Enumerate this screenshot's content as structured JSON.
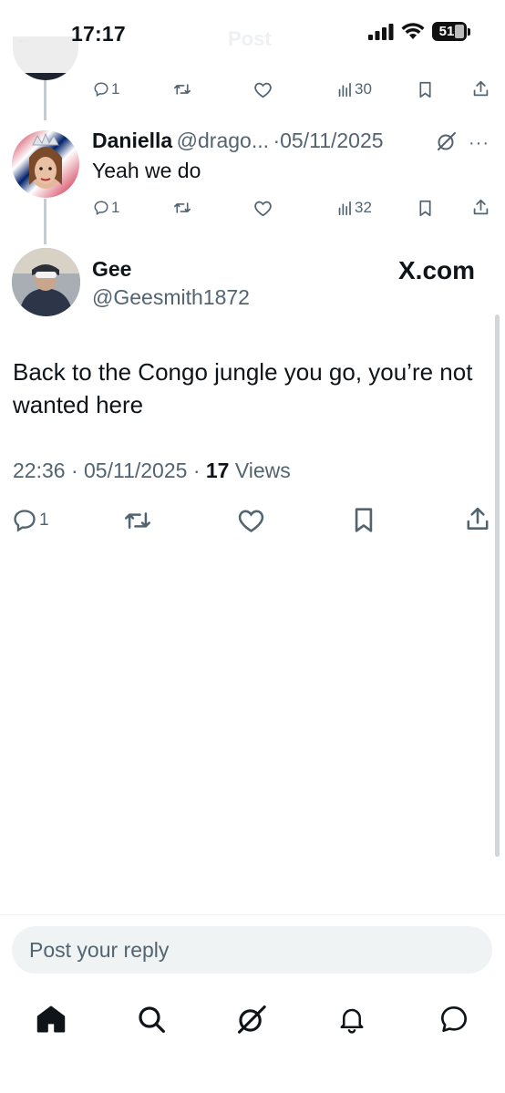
{
  "status_bar": {
    "time": "17:17",
    "battery": "51",
    "ghost_title": "Post",
    "icons": [
      "signal-icon",
      "wifi-icon",
      "battery-icon"
    ]
  },
  "reply_above": {
    "stats": {
      "replies": "1",
      "views": "30"
    }
  },
  "reply_daniella": {
    "name": "Daniella",
    "handle": "@drago...",
    "separator": "·",
    "date": "05/11/2025",
    "text": "Yeah we do",
    "stats": {
      "replies": "1",
      "views": "32"
    }
  },
  "main_post": {
    "name": "Gee",
    "handle": "@Geesmith1872",
    "brand": "X.com",
    "text": "Back to the Congo jungle you go, you’re not wanted here",
    "time": "22:36",
    "separator": "·",
    "date": "05/11/2025",
    "views_count": "17",
    "views_label": "Views",
    "stats": {
      "replies": "1"
    }
  },
  "composer": {
    "placeholder": "Post your reply"
  },
  "bottom_nav": [
    "home-icon",
    "search-icon",
    "grok-icon",
    "notifications-icon",
    "messages-icon"
  ],
  "colors": {
    "text": "#0f1419",
    "secondary": "#536471",
    "composer_bg": "#eff3f4",
    "thread_line": "#c5cdd3"
  }
}
